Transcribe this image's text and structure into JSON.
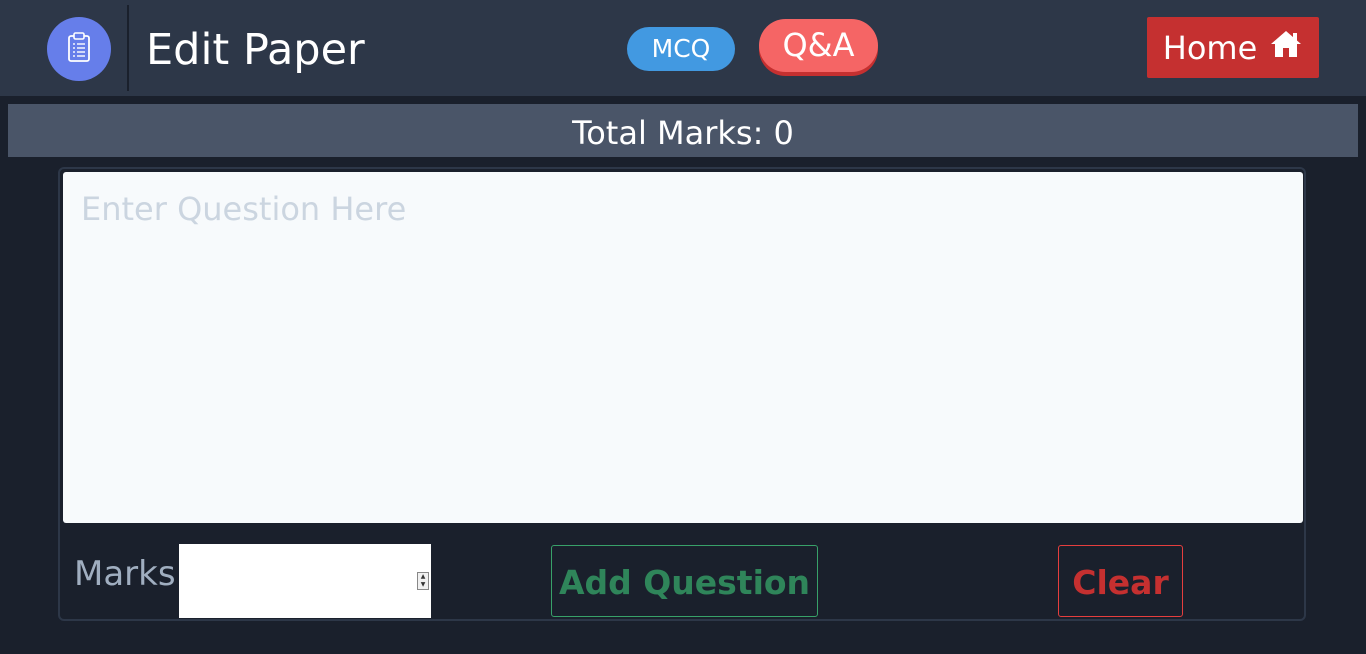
{
  "header": {
    "logo_icon": "clipboard-icon",
    "title": "Edit Paper",
    "tabs": [
      {
        "label": "MCQ",
        "color": "#4299e1"
      },
      {
        "label": "Q&A",
        "color": "#f56565",
        "active": true
      }
    ],
    "home_button": {
      "label": "Home",
      "icon": "home-icon",
      "color": "#c53030"
    }
  },
  "summary": {
    "total_marks_text": "Total Marks: 0"
  },
  "form": {
    "question_placeholder": "Enter Question Here",
    "question_value": "",
    "marks_label": "Marks",
    "marks_value": "",
    "add_button_label": "Add Question",
    "clear_button_label": "Clear"
  },
  "colors": {
    "background": "#1a202c",
    "header": "#2d3748",
    "accent": "#667eea",
    "success": "#2f855a",
    "danger": "#c53030"
  }
}
